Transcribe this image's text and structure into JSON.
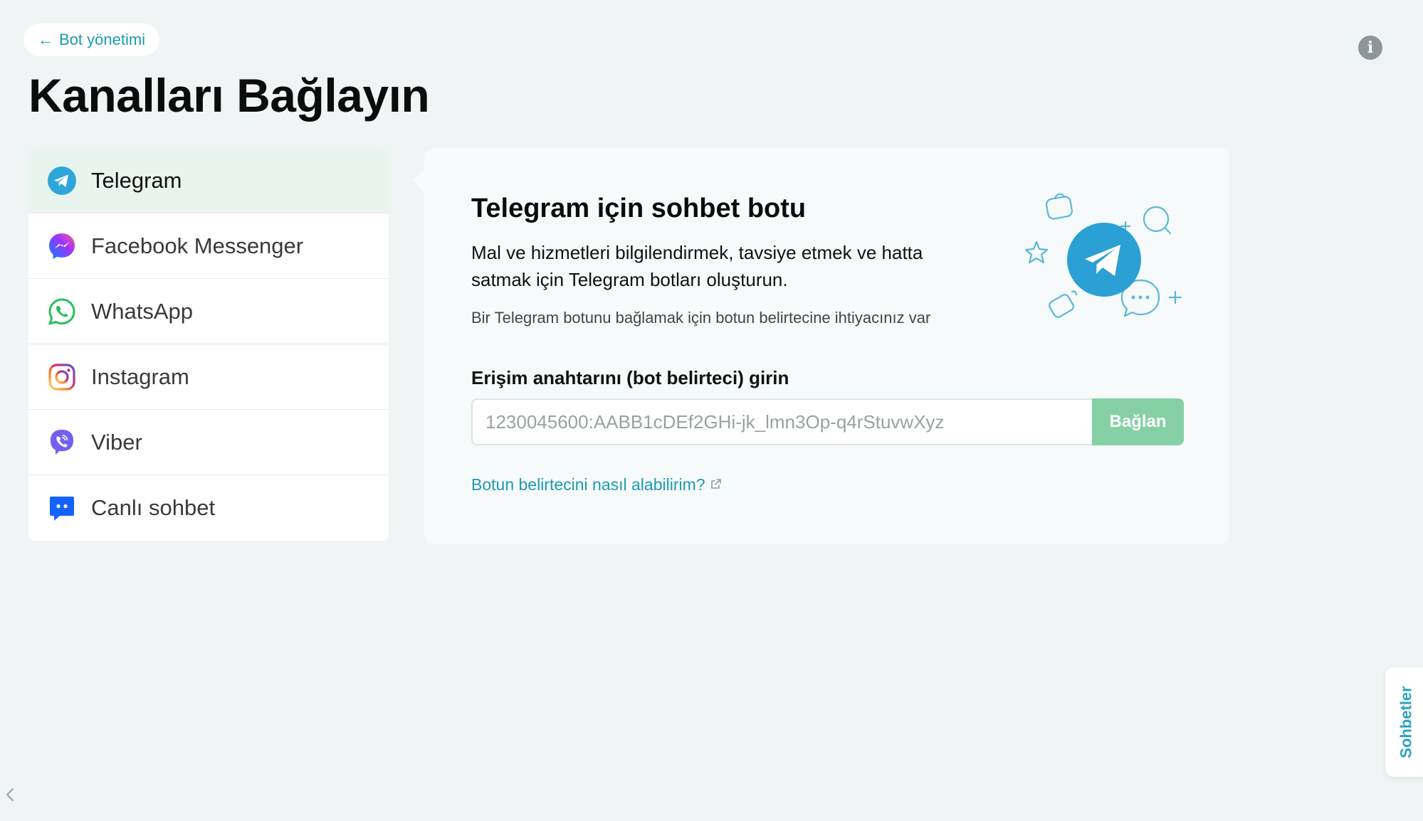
{
  "nav": {
    "back_label": "Bot yönetimi",
    "back_arrow": "←"
  },
  "header": {
    "title": "Kanalları Bağlayın",
    "info_glyph": "i"
  },
  "channels": [
    {
      "label": "Telegram",
      "icon": "telegram-icon",
      "active": true
    },
    {
      "label": "Facebook Messenger",
      "icon": "messenger-icon",
      "active": false
    },
    {
      "label": "WhatsApp",
      "icon": "whatsapp-icon",
      "active": false
    },
    {
      "label": "Instagram",
      "icon": "instagram-icon",
      "active": false
    },
    {
      "label": "Viber",
      "icon": "viber-icon",
      "active": false
    },
    {
      "label": "Canlı sohbet",
      "icon": "live-chat-icon",
      "active": false
    }
  ],
  "card": {
    "title": "Telegram için sohbet botu",
    "description": "Mal ve hizmetleri bilgilendirmek, tavsiye etmek ve hatta satmak için Telegram botları oluşturun.",
    "note": "Bir Telegram botunu bağlamak için botun belirtecine ihtiyacınız var",
    "field_label": "Erişim anahtarını (bot belirteci) girin",
    "input_placeholder": "1230045600:AABB1cDEf2GHi-jk_lmn3Op-q4rStuvwXyz",
    "input_value": "",
    "connect_label": "Bağlan",
    "help_link": "Botun belirtecini nasıl alabilirim?"
  },
  "side_tab": {
    "label": "Sohbetler"
  },
  "colors": {
    "accent": "#1a9bb4",
    "background": "#f0f4f4",
    "active_item": "#e8f5ee",
    "connect_button": "#86d0a6",
    "telegram_blue": "#2ea6da"
  }
}
